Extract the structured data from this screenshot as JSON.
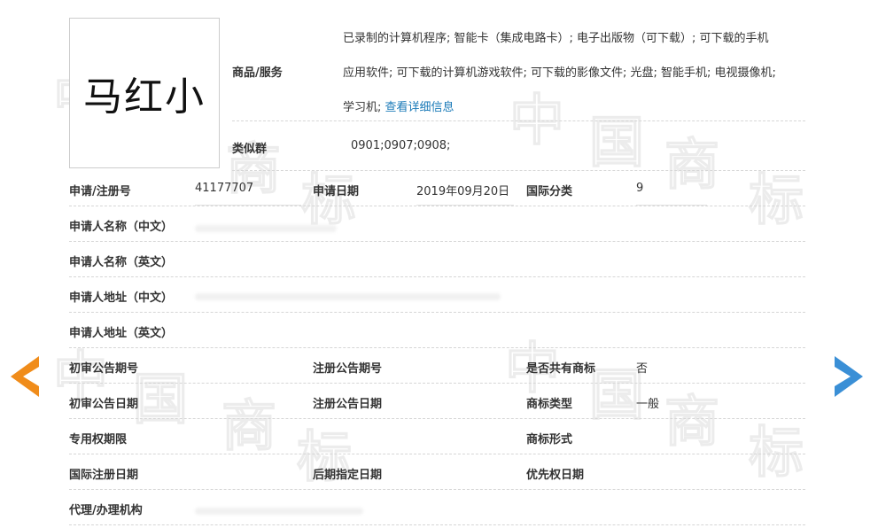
{
  "watermark": [
    "中",
    "国",
    "商",
    "标"
  ],
  "trademark": {
    "image_text": "马红小"
  },
  "goods": {
    "label": "商品/服务",
    "lines": [
      "已录制的计算机程序; 智能卡（集成电路卡）; 电子出版物（可下载）; 可下载的手机",
      "应用软件; 可下载的计算机游戏软件; 可下载的影像文件; 光盘; 智能手机; 电视摄像机;",
      "学习机;"
    ],
    "detail_link": "查看详细信息"
  },
  "similar_group": {
    "label": "类似群",
    "value": "0901;0907;0908;"
  },
  "fields": {
    "reg_no_label": "申请/注册号",
    "reg_no": "41177707",
    "apply_date_label": "申请日期",
    "apply_date": "2019年09月20日",
    "intl_class_label": "国际分类",
    "intl_class": "9",
    "applicant_cn_label": "申请人名称（中文）",
    "applicant_en_label": "申请人名称（英文）",
    "address_cn_label": "申请人地址（中文）",
    "address_en_label": "申请人地址（英文）",
    "prelim_issue_label": "初审公告期号",
    "reg_issue_label": "注册公告期号",
    "shared_label": "是否共有商标",
    "shared": "否",
    "prelim_date_label": "初审公告日期",
    "reg_date_label": "注册公告日期",
    "tm_type_label": "商标类型",
    "tm_type": "一般",
    "exclusive_period_label": "专用权期限",
    "tm_form_label": "商标形式",
    "intl_reg_date_label": "国际注册日期",
    "later_designation_label": "后期指定日期",
    "priority_date_label": "优先权日期",
    "agent_label": "代理/办理机构"
  },
  "nav": {
    "prev": "left-arrow",
    "next": "right-arrow",
    "prev_color": "#f08c1a",
    "next_color": "#3a8fd6"
  }
}
